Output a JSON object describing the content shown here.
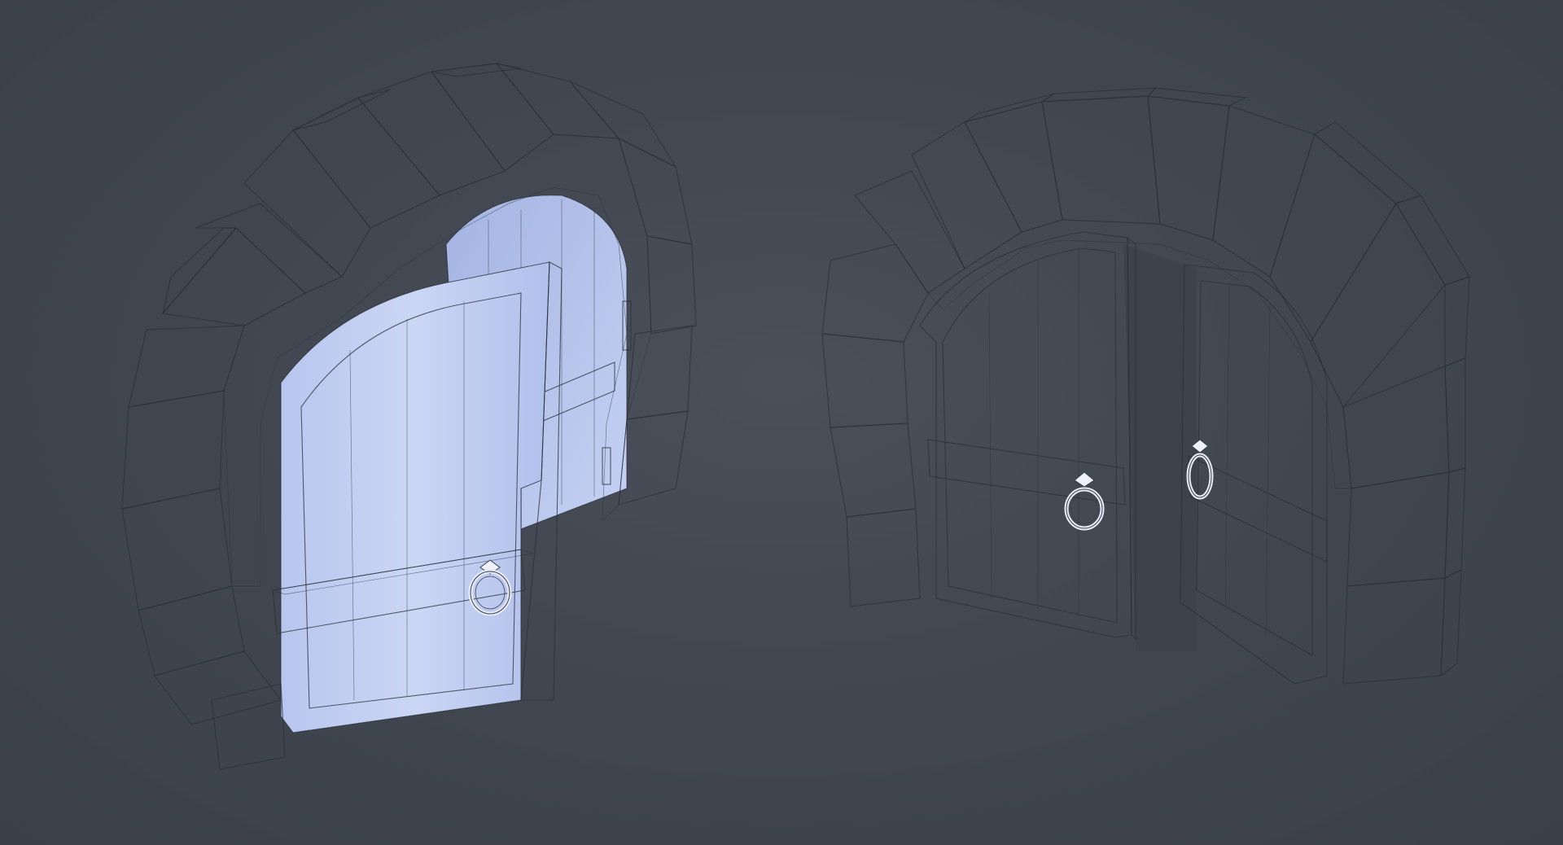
{
  "scene": {
    "background_color": "#414750",
    "material_color": "#c7d3f2",
    "material_shadow_color": "#8f9fcf",
    "material_highlight_color": "#eef2fb",
    "wireframe_color": "#2b3038",
    "objects": [
      {
        "name": "single-door-arch",
        "door_state": "open"
      },
      {
        "name": "double-door-arch",
        "door_state": "ajar"
      }
    ]
  }
}
